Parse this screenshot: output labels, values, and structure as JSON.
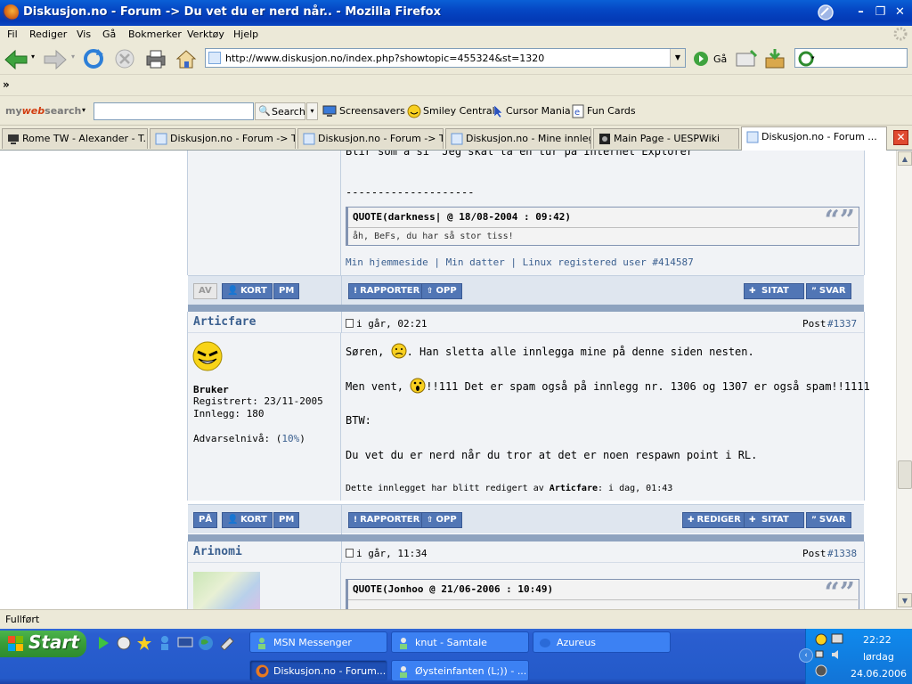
{
  "window": {
    "title": "Diskusjon.no - Forum -> Du vet du er nerd når.. - Mozilla Firefox"
  },
  "menu": [
    "Fil",
    "Rediger",
    "Vis",
    "Gå",
    "Bokmerker",
    "Verktøy",
    "Hjelp"
  ],
  "nav": {
    "url": "http://www.diskusjon.no/index.php?showtopic=455324&st=1320",
    "go_label": "Gå"
  },
  "bookmarks": {
    "chevron": "»"
  },
  "websearch": {
    "logo_my": "my",
    "logo_web": "web",
    "logo_search": "search",
    "search_label": "Search",
    "items": [
      "Screensavers",
      "Smiley Central",
      "Cursor Mania",
      "Fun Cards"
    ]
  },
  "tabs": [
    {
      "label": "Rome TW - Alexander - T...",
      "active": false
    },
    {
      "label": "Diskusjon.no - Forum -> T...",
      "active": false
    },
    {
      "label": "Diskusjon.no - Forum -> T...",
      "active": false
    },
    {
      "label": "Diskusjon.no - Mine innlegg",
      "active": false
    },
    {
      "label": "Main Page - UESPWiki",
      "active": false
    },
    {
      "label": "Diskusjon.no - Forum ...",
      "active": true
    }
  ],
  "post_top": {
    "body_partial": "Blir som å si \"Jeg skal ta en tur på Internet Explorer\"",
    "dashes": "--------------------",
    "quote_header": "QUOTE(darkness| @ 18/08-2004 : 09:42)",
    "quote_body": "åh, BeFs, du har så stor tiss!",
    "signature": "Min hjemmeside | Min datter | Linux registered user #414587",
    "buttons_left": [
      "AV",
      "KORT",
      "PM"
    ],
    "buttons_mid": [
      "RAPPORTER",
      "OPP"
    ],
    "buttons_right": [
      "SITAT",
      "SVAR"
    ]
  },
  "post_1337": {
    "author": "Articfare",
    "date": "i går, 02:21",
    "post_label": "Post",
    "post_num": "#1337",
    "role": "Bruker",
    "registered": "Registrert: 23/11-2005",
    "posts": "Innlegg: 180",
    "warning_label": "Advarselnivå: (",
    "warning_pct": "10%",
    "warning_close": ")",
    "line1a": "Søren,",
    "line1b": ". Han sletta alle innlegga mine på denne siden nesten.",
    "line2a": "Men vent,",
    "line2b": "!!111 Det er spam også på innlegg nr. 1306 og 1307 er også spam!!1111",
    "line3": "BTW:",
    "line4": "Du vet du er nerd når du tror at det er noen respawn point i RL.",
    "edited_prefix": "Dette innlegget har blitt redigert av",
    "edited_by": "Articfare",
    "edited_suffix": ": i dag, 01:43",
    "buttons_left": [
      "PÅ",
      "KORT",
      "PM"
    ],
    "buttons_mid": [
      "RAPPORTER",
      "OPP"
    ],
    "buttons_right": [
      "REDIGER",
      "SITAT",
      "SVAR"
    ]
  },
  "post_1338": {
    "author": "Arinomi",
    "date": "i går, 11:34",
    "post_label": "Post",
    "post_num": "#1338",
    "quote_header": "QUOTE(Jonhoo @ 21/06-2006 : 10:49)"
  },
  "status": {
    "text": "Fullført"
  },
  "taskbar": {
    "start": "Start",
    "buttons": [
      "MSN Messenger",
      "knut - Samtale",
      "Azureus",
      "Diskusjon.no - Forum...",
      "Øysteinfanten (L;)) - ..."
    ],
    "time": "22:22",
    "day": "lørdag",
    "date": "24.06.2006"
  }
}
